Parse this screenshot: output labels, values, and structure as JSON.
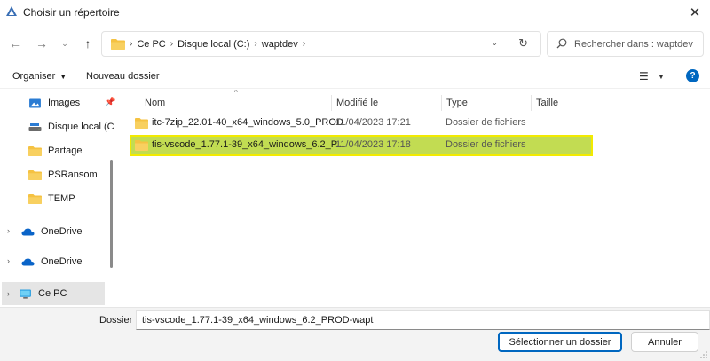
{
  "window": {
    "title": "Choisir un répertoire",
    "close_glyph": "✕"
  },
  "nav": {
    "back_glyph": "←",
    "forward_glyph": "→",
    "recent_glyph": "⌄",
    "up_glyph": "↑"
  },
  "address": {
    "crumbs": [
      "Ce PC",
      "Disque local (C:)",
      "waptdev"
    ],
    "separator": "›",
    "dropdown_glyph": "⌄",
    "refresh_glyph": "↻"
  },
  "search": {
    "placeholder": "Rechercher dans : waptdev"
  },
  "toolbar": {
    "organiser": "Organiser",
    "organiser_caret": "▼",
    "nouveau": "Nouveau dossier",
    "view_glyph": "☰",
    "view_caret": "▼",
    "help_glyph": "?"
  },
  "sidebar": {
    "items": [
      {
        "label": "Images",
        "icon": "images-icon",
        "pinned": true
      },
      {
        "label": "Disque local (C",
        "icon": "drive-icon"
      },
      {
        "label": "Partage",
        "icon": "folder-icon"
      },
      {
        "label": "PSRansom",
        "icon": "folder-icon"
      },
      {
        "label": "TEMP",
        "icon": "folder-icon"
      },
      {
        "label": "OneDrive",
        "icon": "onedrive-icon",
        "expandable": true
      },
      {
        "label": "OneDrive",
        "icon": "onedrive-icon",
        "expandable": true
      },
      {
        "label": "Ce PC",
        "icon": "pc-icon",
        "expandable": true,
        "selected": true
      }
    ],
    "expander_glyph": "›",
    "pin_glyph": "📌"
  },
  "filelist": {
    "sort_glyph": "^",
    "columns": [
      "Nom",
      "Modifié le",
      "Type",
      "Taille"
    ],
    "rows": [
      {
        "name": "itc-7zip_22.01-40_x64_windows_5.0_PROD",
        "modified": "11/04/2023 17:21",
        "type": "Dossier de fichiers",
        "selected": false
      },
      {
        "name": "tis-vscode_1.77.1-39_x64_windows_6.2_P...",
        "modified": "11/04/2023 17:18",
        "type": "Dossier de fichiers",
        "selected": true
      }
    ]
  },
  "footer": {
    "dossier_label": "Dossier :",
    "dossier_value": "tis-vscode_1.77.1-39_x64_windows_6.2_PROD-wapt",
    "select_button": "Sélectionner un dossier",
    "cancel_button": "Annuler"
  },
  "colors": {
    "accent": "#0067c0",
    "folder": "#f5c242",
    "selection": "#c2dc52",
    "selection_border": "#f2ea00"
  }
}
